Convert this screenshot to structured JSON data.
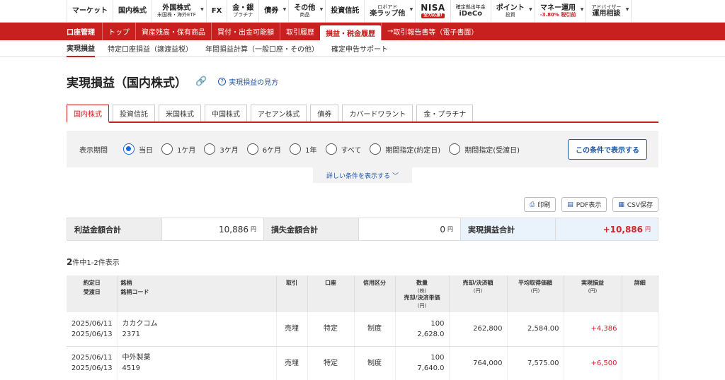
{
  "topnav": [
    {
      "label": "マーケット",
      "sub": "",
      "drop": false
    },
    {
      "label": "国内株式",
      "sub": "",
      "drop": false
    },
    {
      "label": "外国株式",
      "sub": "米国株・海外ETF",
      "drop": true
    },
    {
      "label": "FX",
      "sub": "",
      "drop": false
    },
    {
      "label": "金・銀",
      "sub": "プラチナ",
      "drop": false
    },
    {
      "label": "債券",
      "sub": "",
      "drop": true
    },
    {
      "label": "その他",
      "sub": "商品",
      "drop": true
    },
    {
      "label": "投資信託",
      "sub": "",
      "drop": false
    },
    {
      "label": "ロボアド",
      "sub": "楽ラップ他",
      "drop": true
    },
    {
      "label": "NISA",
      "sub": "全力応援!",
      "drop": false
    },
    {
      "label": "確定拠出年金",
      "sub": "iDeCo",
      "drop": false
    },
    {
      "label": "ポイント",
      "sub": "投資",
      "drop": true
    },
    {
      "label": "マネー運用",
      "sub": "-3.80% 税引前",
      "drop": true
    },
    {
      "label": "アドバイザー",
      "sub": "運用相談",
      "drop": true
    }
  ],
  "redbar": {
    "lead": "口座管理",
    "tabs": [
      "トップ",
      "資産残高・保有商品",
      "買付・出金可能額",
      "取引履歴",
      "損益・税金履歴",
      "取引報告書等（電子書面）"
    ],
    "active": 4
  },
  "subnav": [
    "実現損益",
    "特定口座損益（譲渡益税）",
    "年間損益計算（一般口座・その他）",
    "確定申告サポート"
  ],
  "title": "実現損益（国内株式）",
  "help": "実現損益の見方",
  "product_tabs": [
    "国内株式",
    "投資信託",
    "米国株式",
    "中国株式",
    "アセアン株式",
    "債券",
    "カバードワラント",
    "金・プラチナ"
  ],
  "filter": {
    "label": "表示期間",
    "options": [
      "当日",
      "1ケ月",
      "3ケ月",
      "6ケ月",
      "1年",
      "すべて",
      "期間指定(約定日)",
      "期間指定(受渡日)"
    ],
    "selected": "当日",
    "submit": "この条件で表示する",
    "more": "詳しい条件を表示する"
  },
  "tools": {
    "print": "印刷",
    "pdf": "PDF表示",
    "csv": "CSV保存"
  },
  "summary": {
    "profit_label": "利益金額合計",
    "profit_value": "10,886",
    "loss_label": "損失金額合計",
    "loss_value": "0",
    "total_label": "実現損益合計",
    "total_value": "+10,886",
    "unit": "円"
  },
  "count": {
    "total": "2",
    "text": "件中1-2件表示"
  },
  "table": {
    "headers": {
      "date1": "約定日",
      "date2": "受渡日",
      "name1": "銘柄",
      "name2": "銘柄コード",
      "trade": "取引",
      "account": "口座",
      "margin": "信用区分",
      "qty": "数量",
      "qty_unit": "(株)",
      "price": "売却/決済単価",
      "price_unit": "(円)",
      "amount": "売却/決済額",
      "amount_unit": "(円)",
      "avg": "平均取得価額",
      "avg_unit": "(円)",
      "pl": "実現損益",
      "pl_unit": "(円)",
      "detail": "詳細"
    },
    "rows": [
      {
        "trade_date": "2025/06/11",
        "settle_date": "2025/06/13",
        "name": "カカクコム",
        "code": "2371",
        "trade": "売埋",
        "account": "特定",
        "margin": "制度",
        "qty": "100",
        "price": "2,628.0",
        "amount": "262,800",
        "avg": "2,584.00",
        "pl": "+4,386"
      },
      {
        "trade_date": "2025/06/11",
        "settle_date": "2025/06/13",
        "name": "中外製薬",
        "code": "4519",
        "trade": "売埋",
        "account": "特定",
        "margin": "制度",
        "qty": "100",
        "price": "7,640.0",
        "amount": "764,000",
        "avg": "7,575.00",
        "pl": "+6,500"
      }
    ]
  }
}
